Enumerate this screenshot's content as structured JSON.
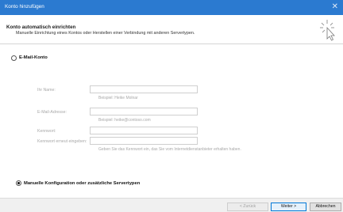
{
  "window": {
    "title": "Konto hinzufügen",
    "close_glyph": "✕"
  },
  "header": {
    "title": "Konto automatisch einrichten",
    "subtitle": "Manuelle Einrichtung eines Kontos oder Herstellen einer Verbindung mit anderen Servertypen.",
    "icon": "wizard-cursor-icon"
  },
  "options": {
    "email_account": {
      "label": "E-Mail-Konto",
      "selected": false
    },
    "manual": {
      "label": "Manuelle Konfiguration oder zusätzliche Servertypen",
      "selected": true
    }
  },
  "form": {
    "name": {
      "label": "Ihr Name:",
      "value": "",
      "hint": "Beispiel: Heike Molnar"
    },
    "email": {
      "label": "E-Mail-Adresse:",
      "value": "",
      "hint": "Beispiel: heike@contoso.com"
    },
    "password": {
      "label": "Kennwort:",
      "value": ""
    },
    "password_confirm": {
      "label": "Kennwort erneut eingeben:",
      "value": ""
    },
    "password_hint": "Geben Sie das Kennwort ein, das Sie vom Internetdienstanbieter erhalten haben."
  },
  "buttons": {
    "back": "< Zurück",
    "next": "Weiter >",
    "cancel": "Abbrechen"
  },
  "colors": {
    "titlebar": "#2b7ad0",
    "primary_button_border": "#0078d7"
  }
}
